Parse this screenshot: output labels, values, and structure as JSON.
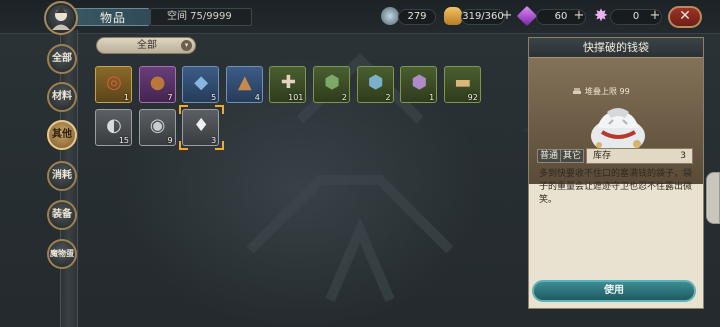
{
  "header": {
    "title": "物品",
    "space_label": "空间 75/9999",
    "resources": [
      {
        "icon": "moon-gem-icon",
        "value": "279",
        "color": "#9fb7c2"
      },
      {
        "icon": "bread-icon",
        "value": "319/360",
        "color": "#e1a94a"
      },
      {
        "icon": "purple-crystal-icon",
        "value": "60",
        "color": "#b04ad8"
      },
      {
        "icon": "star-crystal-icon",
        "value": "0",
        "color": "#e7a4e8"
      }
    ],
    "plus_symbol": "+",
    "close_symbol": "✕"
  },
  "nav": {
    "items": [
      {
        "label": "全部",
        "active": false
      },
      {
        "label": "材料",
        "active": false
      },
      {
        "label": "其他",
        "active": true
      },
      {
        "label": "消耗",
        "active": false
      },
      {
        "label": "装备",
        "active": false
      },
      {
        "label": "魔物蛋",
        "active": false
      }
    ]
  },
  "filter": {
    "selected": "全部",
    "arrow": "▾"
  },
  "items": [
    {
      "name": "compass-ring",
      "count": "1",
      "quality": "gold",
      "glyph": "◎",
      "color": "#e05a3a"
    },
    {
      "name": "bronze-coin",
      "count": "7",
      "quality": "purple",
      "glyph": "●",
      "color": "#b8783a"
    },
    {
      "name": "blue-book",
      "count": "5",
      "quality": "blue",
      "glyph": "◆",
      "color": "#86b5e0"
    },
    {
      "name": "scroll-bag",
      "count": "4",
      "quality": "blue",
      "glyph": "▲",
      "color": "#c9894a"
    },
    {
      "name": "bone",
      "count": "101",
      "quality": "green",
      "glyph": "✚",
      "color": "#e4d4be"
    },
    {
      "name": "green-ore",
      "count": "2",
      "quality": "green",
      "glyph": "⬢",
      "color": "#7ea86a"
    },
    {
      "name": "blue-ore",
      "count": "2",
      "quality": "green",
      "glyph": "⬢",
      "color": "#7ab0c8"
    },
    {
      "name": "purple-ore",
      "count": "1",
      "quality": "green",
      "glyph": "⬢",
      "color": "#b08ac8"
    },
    {
      "name": "map-scroll",
      "count": "92",
      "quality": "green",
      "glyph": "▬",
      "color": "#d8b878"
    },
    {
      "name": "silver-pouch",
      "count": "15",
      "quality": "white",
      "glyph": "◐",
      "color": "#d8dadc"
    },
    {
      "name": "coin-sack",
      "count": "9",
      "quality": "white",
      "glyph": "◉",
      "color": "#c9cdd0"
    },
    {
      "name": "busted-money-bag",
      "count": "3",
      "quality": "white",
      "glyph": "♦",
      "color": "#eef0f2",
      "selected": true
    }
  ],
  "detail": {
    "title": "快撑破的钱袋",
    "stack_label": "堆叠上限 99",
    "tag_common": "普通",
    "tag_other": "其它",
    "stock_label": "库存",
    "stock_value": "3",
    "description": "多到快要收不住口的塞满钱的袋子，袋子的重量会让遮迹守卫也忍不住露出微笑。",
    "use_label": "使用"
  }
}
